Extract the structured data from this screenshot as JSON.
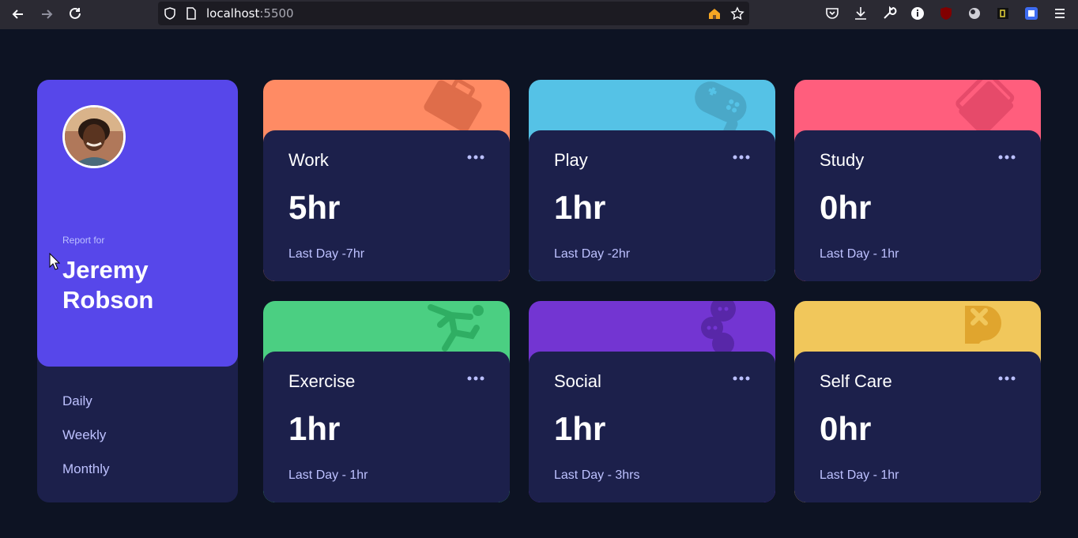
{
  "browser": {
    "url_host": "localhost",
    "url_port": ":5500",
    "icons": [
      "back-icon",
      "forward-icon",
      "reload-icon",
      "shield-icon",
      "page-icon",
      "home-icon",
      "bookmark-star-icon",
      "pocket-icon",
      "download-icon",
      "wrench-icon",
      "info-icon",
      "ublock-icon",
      "extension-icon",
      "extension-icon",
      "extension-icon",
      "menu-icon"
    ]
  },
  "profile": {
    "report_label": "Report for",
    "name_first": "Jeremy",
    "name_last": "Robson"
  },
  "periods": [
    "Daily",
    "Weekly",
    "Monthly"
  ],
  "cards": [
    {
      "title": "Work",
      "current": "5hr",
      "previous": "Last Day -7hr",
      "color": "#ff8b64",
      "icon": "briefcase-icon"
    },
    {
      "title": "Play",
      "current": "1hr",
      "previous": "Last Day -2hr",
      "color": "#55c2e6",
      "icon": "gamepad-icon"
    },
    {
      "title": "Study",
      "current": "0hr",
      "previous": "Last Day - 1hr",
      "color": "#ff5e7d",
      "icon": "books-icon"
    },
    {
      "title": "Exercise",
      "current": "1hr",
      "previous": "Last Day - 1hr",
      "color": "#4bcf82",
      "icon": "runner-icon"
    },
    {
      "title": "Social",
      "current": "1hr",
      "previous": "Last Day - 3hrs",
      "color": "#7335d2",
      "icon": "social-icon"
    },
    {
      "title": "Self Care",
      "current": "0hr",
      "previous": "Last Day - 1hr",
      "color": "#f1c75b",
      "icon": "heart-bandage-icon"
    }
  ]
}
